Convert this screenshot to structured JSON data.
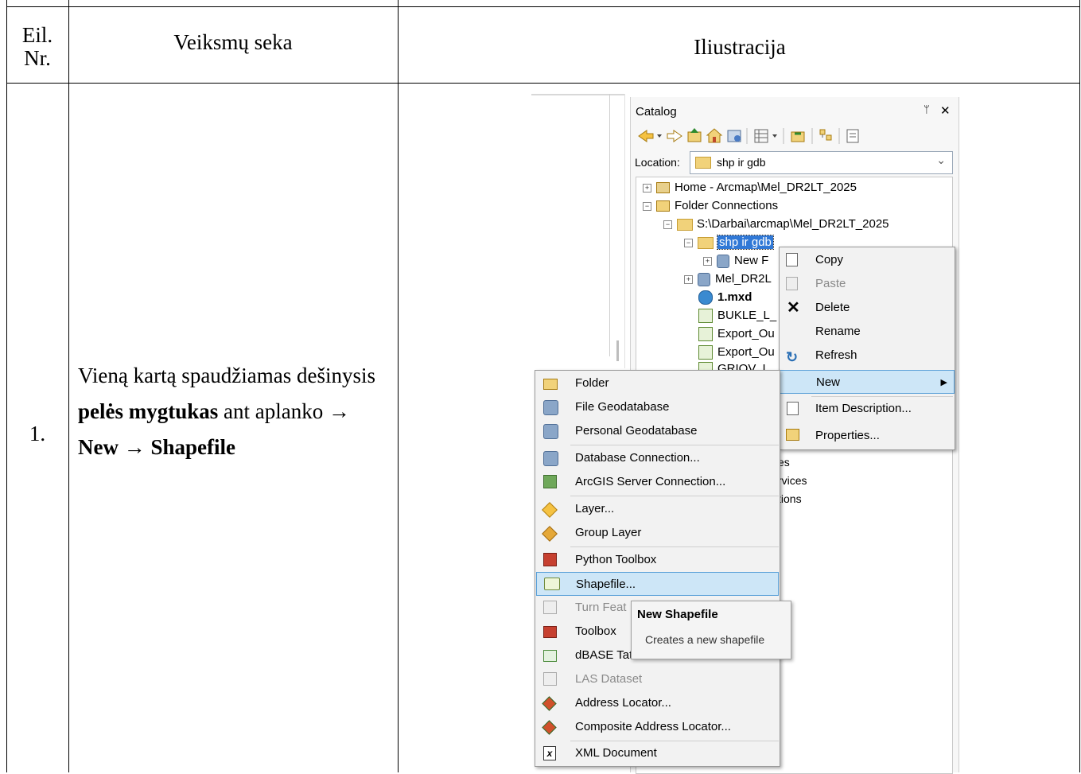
{
  "table": {
    "header": {
      "nr": "Eil.\nNr.",
      "nr_line1": "Eil.",
      "nr_line2": "Nr.",
      "steps": "Veiksmų seka",
      "illustration": "Iliustracija"
    },
    "row": {
      "number": "1.",
      "desc_part1": "Vieną kartą spaudžiamas dešinysis ",
      "desc_bold1": "pelės mygtukas",
      "desc_part2": " ant aplanko → ",
      "desc_bold2": "New",
      "desc_part3": " → ",
      "desc_bold3": "Shapefile"
    }
  },
  "catalog": {
    "title": "Catalog",
    "pin": "ᛘ",
    "close": "✕",
    "location_label": "Location:",
    "location_value": "shp ir gdb",
    "tree": {
      "home": "Home - Arcmap\\Mel_DR2LT_2025",
      "folder_connections": "Folder Connections",
      "sdarbai": "S:\\Darbai\\arcmap\\Mel_DR2LT_2025",
      "shp": "shp ir gdb",
      "newf": "New F",
      "mel": "Mel_DR2L",
      "mxd": "1.mxd",
      "bukle": "BUKLE_L_",
      "export1": "Export_Ou",
      "export2": "Export_Ou",
      "griov": "GRIOV_L_",
      "partial1": "es",
      "partial2": "rvices",
      "partial3": "tions"
    }
  },
  "context_menu": {
    "items": [
      "Copy",
      "Paste",
      "Delete",
      "Rename",
      "Refresh",
      "New",
      "Item Description...",
      "Properties..."
    ]
  },
  "new_submenu": {
    "items": [
      "Folder",
      "File Geodatabase",
      "Personal Geodatabase",
      "Database Connection...",
      "ArcGIS Server Connection...",
      "Layer...",
      "Group Layer",
      "Python Toolbox",
      "Shapefile...",
      "Turn Feat",
      "Toolbox",
      "dBASE Tat",
      "LAS Dataset",
      "Address Locator...",
      "Composite Address Locator...",
      "XML Document"
    ]
  },
  "tooltip": {
    "title": "New Shapefile",
    "text": "Creates a new shapefile"
  }
}
